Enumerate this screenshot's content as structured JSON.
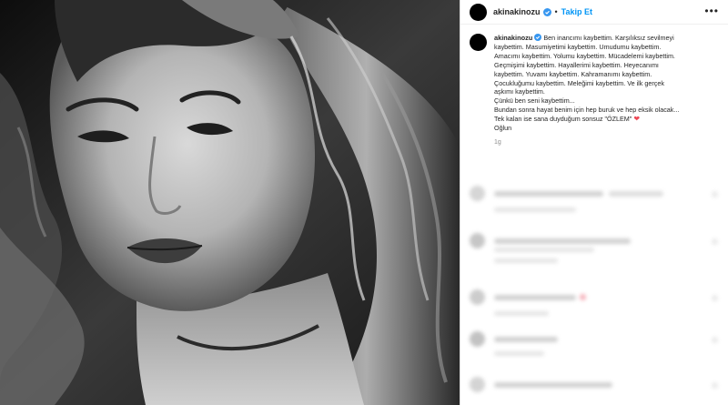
{
  "post": {
    "username": "akinakinozu",
    "separator": "•",
    "follow_label": "Takip Et",
    "more_icon": "more-horizontal-icon",
    "verified_icon": "verified-badge-icon"
  },
  "caption": {
    "username": "akinakinozu",
    "lines": [
      "Ben inancımı kaybettim. Karşılıksız sevilmeyi",
      "kaybettim. Masumiyetimi kaybettim. Umudumu kaybettim.",
      "Amacımı kaybettim. Yolumu kaybettim. Mücadelemi kaybettim.",
      "Geçmişimi kaybettim. Hayallerimi kaybettim. Heyecanımı",
      "kaybettim. Yuvamı kaybettim. Kahramanımı kaybettim.",
      "Çocukluğumu kaybettim. Meleğimi kaybettim. Ve ilk gerçek",
      "aşkımı kaybettim.",
      "Çünkü ben seni kaybettim...",
      "Bundan sonra hayat benim için hep buruk ve hep eksik olacak...",
      "Tek kalan ise sana duyduğum sonsuz \"ÖZLEM\"",
      "Oğlun"
    ],
    "heart": "❤",
    "time": "1g"
  },
  "colors": {
    "follow": "#0095f6",
    "heart": "#ed4956",
    "text": "#262626",
    "muted": "#8e8e8e"
  }
}
